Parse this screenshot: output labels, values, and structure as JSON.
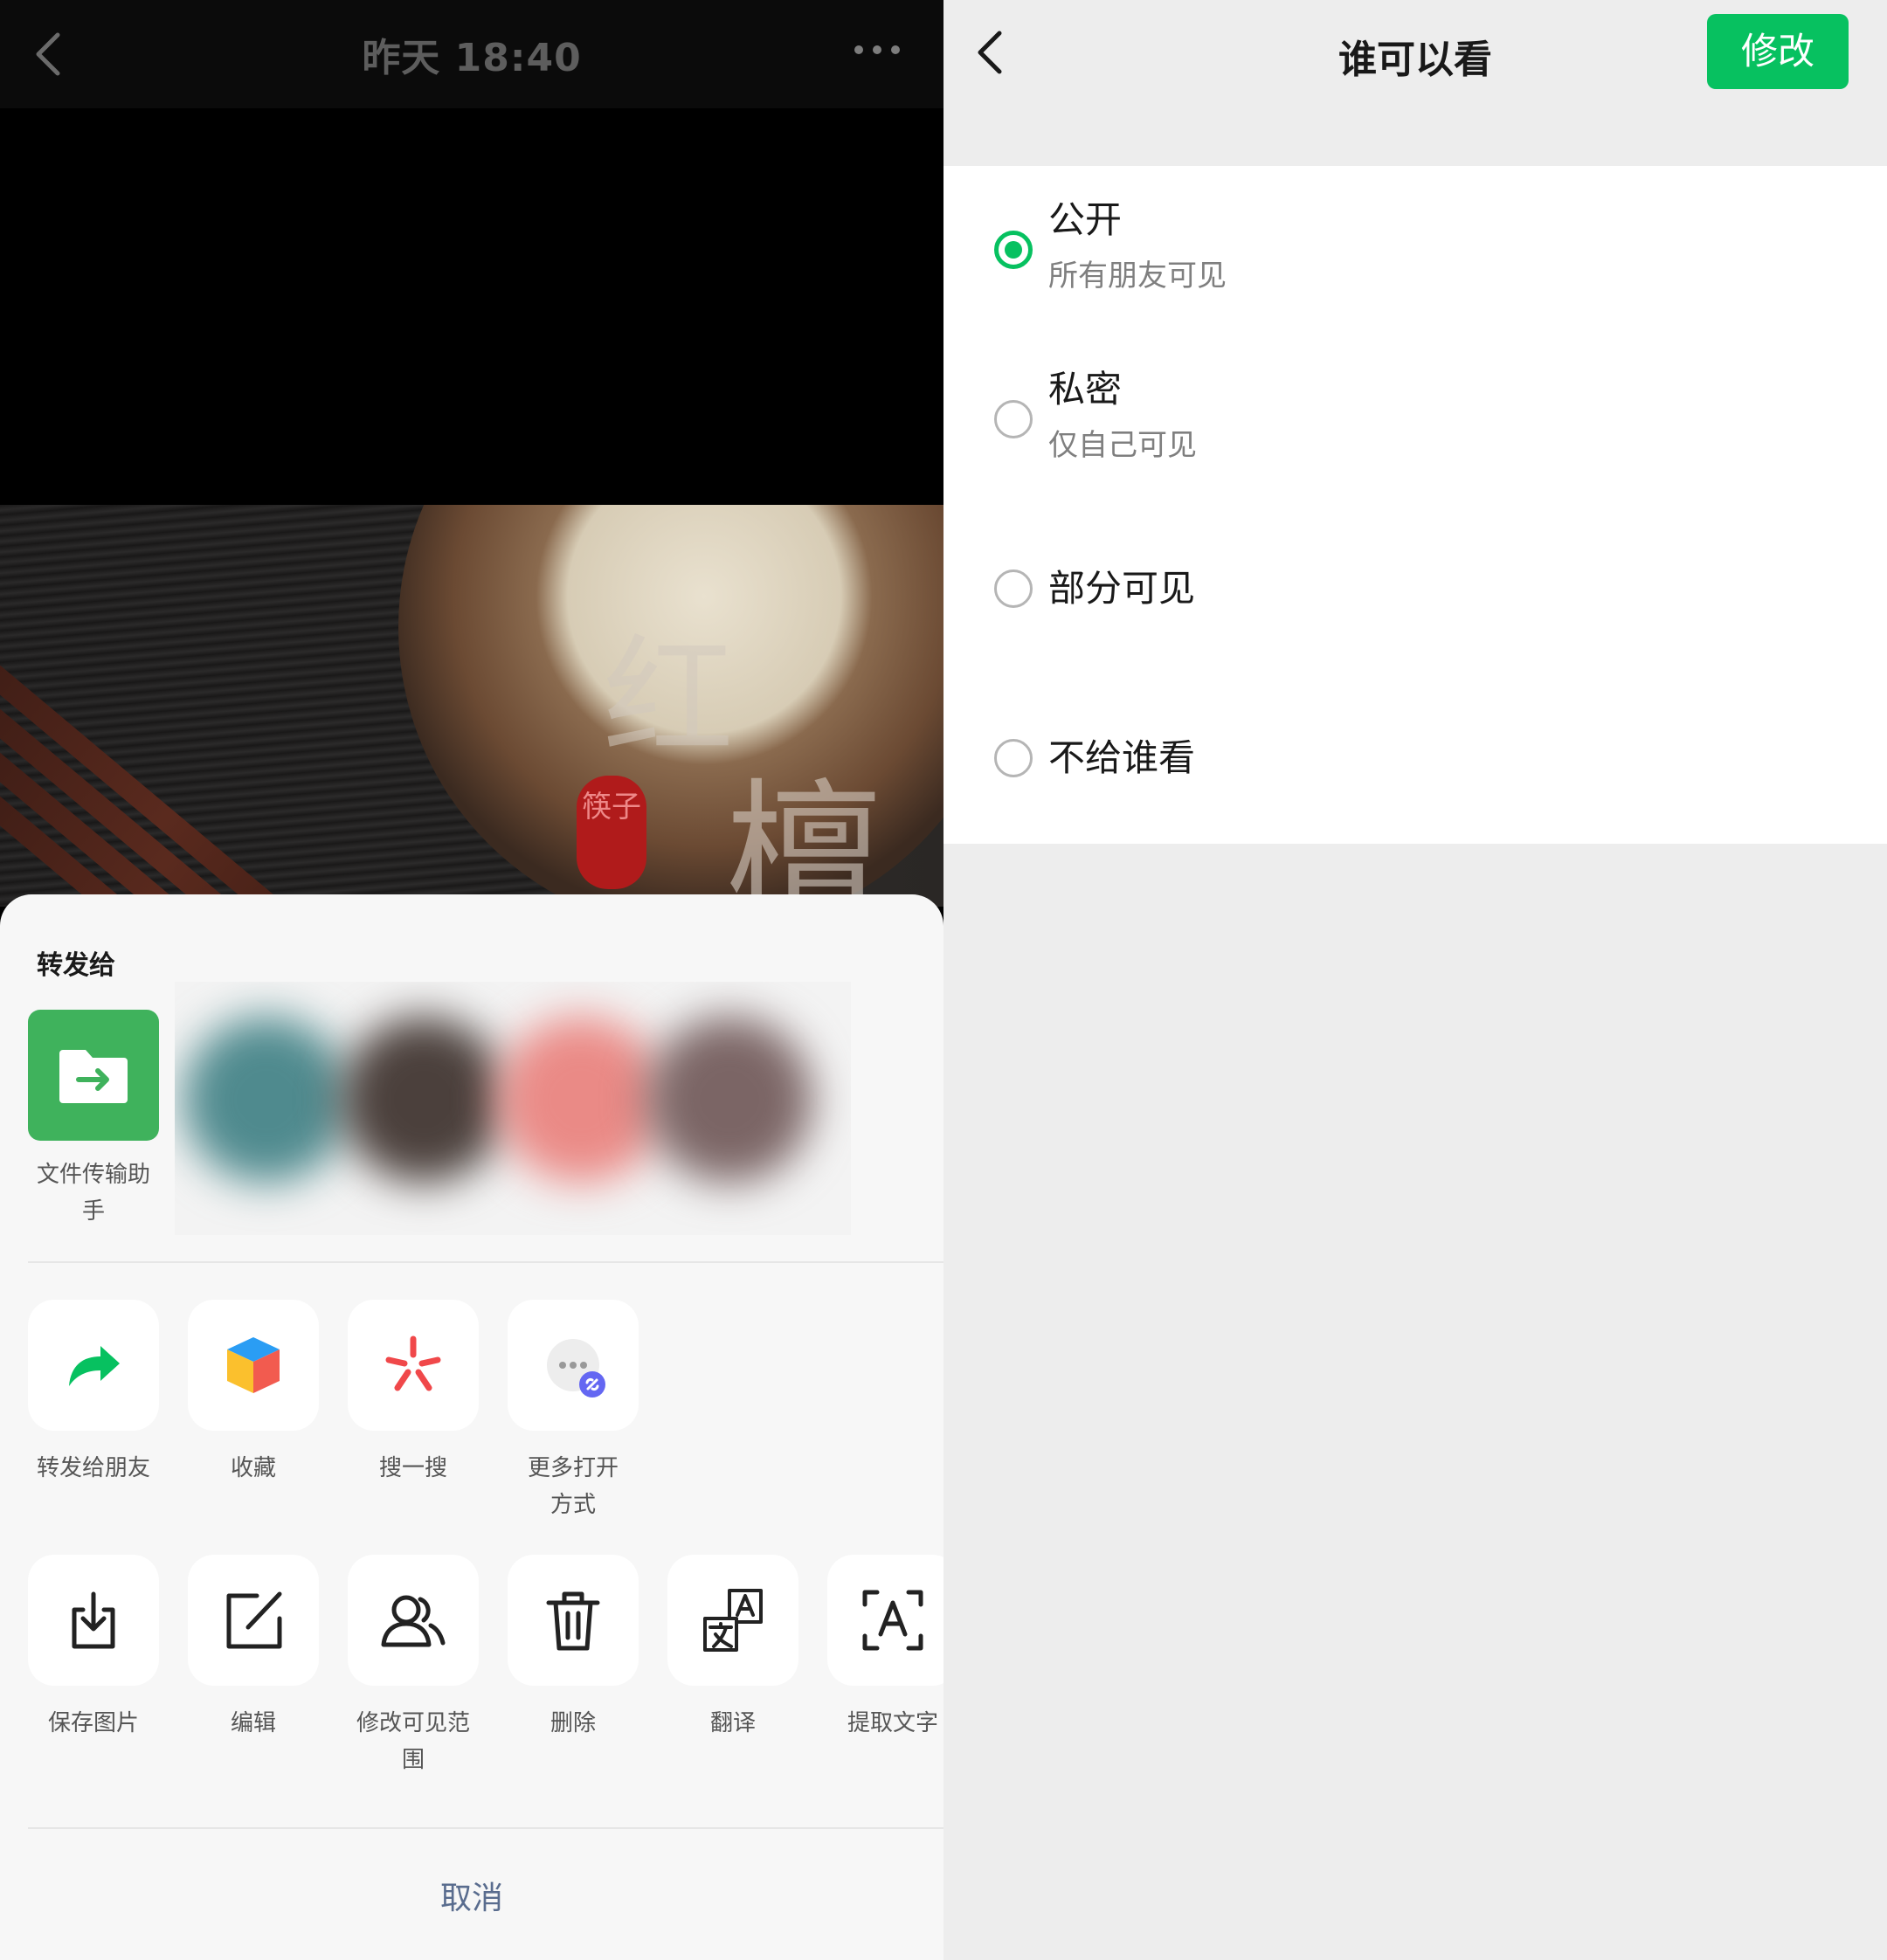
{
  "left": {
    "topbar": {
      "title": "昨天 18:40"
    },
    "photo": {
      "calligraphy_1": "红",
      "calligraphy_2": "檀",
      "seal_text": "筷子"
    },
    "sheet": {
      "forward_title": "转发给",
      "file_transfer_label": "文件传输助手",
      "actions_row1": [
        {
          "label": "转发给朋友",
          "icon": "forward-icon"
        },
        {
          "label": "收藏",
          "icon": "favorite-cube-icon"
        },
        {
          "label": "搜一搜",
          "icon": "search-spark-icon"
        },
        {
          "label": "更多打开方式",
          "icon": "more-open-icon"
        }
      ],
      "actions_row2": [
        {
          "label": "保存图片",
          "icon": "save-image-icon"
        },
        {
          "label": "编辑",
          "icon": "edit-icon"
        },
        {
          "label": "修改可见范围",
          "icon": "visibility-scope-icon"
        },
        {
          "label": "删除",
          "icon": "trash-icon"
        },
        {
          "label": "翻译",
          "icon": "translate-icon"
        },
        {
          "label": "提取文字",
          "icon": "extract-text-icon"
        }
      ],
      "cancel_label": "取消"
    }
  },
  "right": {
    "title": "谁可以看",
    "edit_button": "修改",
    "options": [
      {
        "title": "公开",
        "subtitle": "所有朋友可见",
        "selected": true
      },
      {
        "title": "私密",
        "subtitle": "仅自己可见",
        "selected": false
      },
      {
        "title": "部分可见",
        "subtitle": "",
        "selected": false
      },
      {
        "title": "不给谁看",
        "subtitle": "",
        "selected": false
      }
    ]
  },
  "colors": {
    "accent": "#07c160",
    "file_transfer_tile": "#3fb25c",
    "cancel_text": "#596c8e"
  }
}
